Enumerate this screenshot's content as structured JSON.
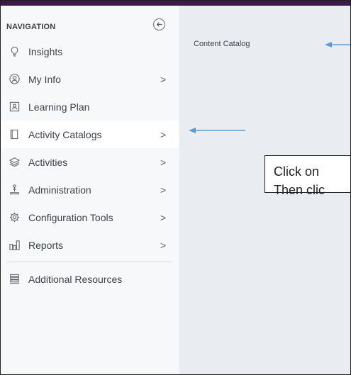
{
  "topbar": {
    "color": "#3b1c46"
  },
  "navigation": {
    "header": "NAVIGATION",
    "collapse_icon": "arrow-left-circle-icon",
    "items": [
      {
        "label": "Insights",
        "icon": "lightbulb-icon",
        "chevron": ""
      },
      {
        "label": "My Info",
        "icon": "person-circle-icon",
        "chevron": ">"
      },
      {
        "label": "Learning Plan",
        "icon": "learning-plan-icon",
        "chevron": ""
      },
      {
        "label": "Activity Catalogs",
        "icon": "book-icon",
        "chevron": ">",
        "active": true
      },
      {
        "label": "Activities",
        "icon": "layers-icon",
        "chevron": ">"
      },
      {
        "label": "Administration",
        "icon": "admin-person-icon",
        "chevron": ">"
      },
      {
        "label": "Configuration Tools",
        "icon": "gear-icon",
        "chevron": ">"
      },
      {
        "label": "Reports",
        "icon": "bar-chart-icon",
        "chevron": ">"
      },
      {
        "label": "Additional Resources",
        "icon": "stack-icon",
        "chevron": ""
      }
    ]
  },
  "main": {
    "content_label": "Content Catalog",
    "instruction": {
      "line1": "Click on ",
      "line2": "Then clic"
    }
  },
  "annotation_color": "#5b9bd5"
}
